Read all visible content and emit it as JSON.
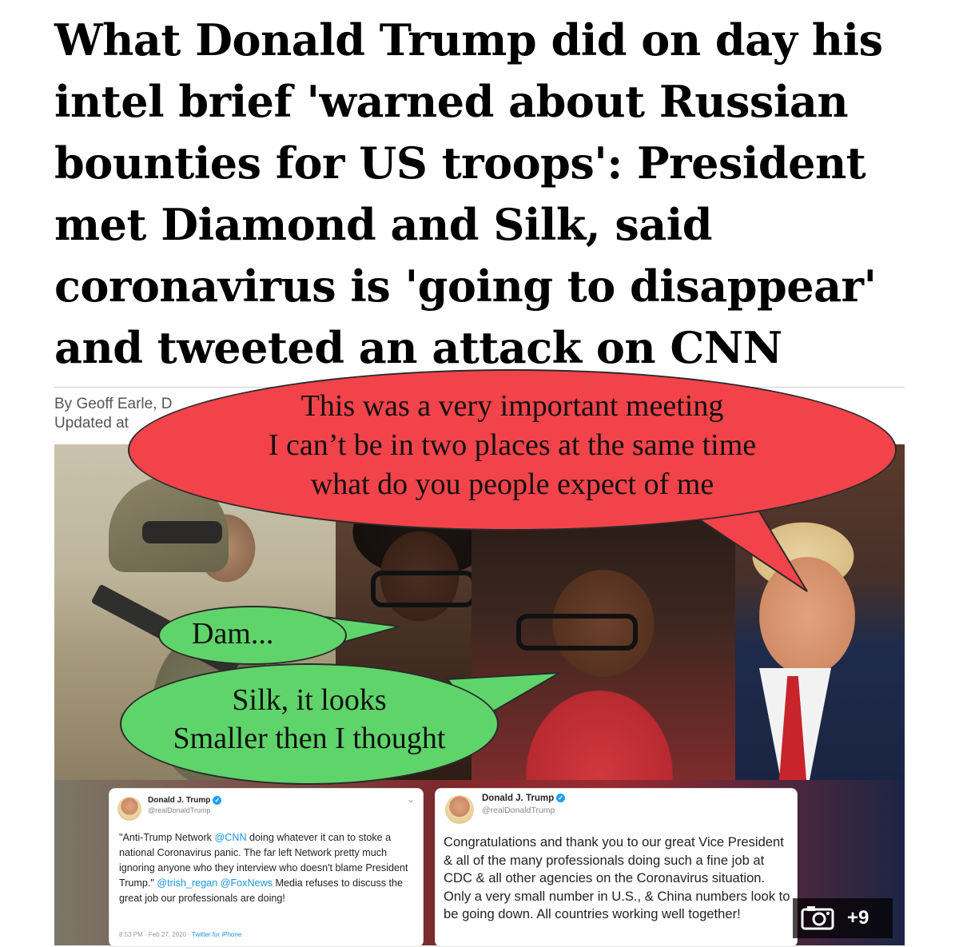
{
  "article": {
    "headline": "What Donald Trump did on day his intel brief 'warned about Russian bounties for US troops': President met Diamond and Silk, said coronavirus is 'going to disappear' and tweeted an attack on CNN",
    "byline": "By Geoff Earle, D",
    "updated": "Updated at"
  },
  "speech_bubbles": {
    "red_lines": [
      "This was a very important meeting",
      "I can’t be in two places at the same time",
      "what do you people expect of me"
    ],
    "green_small": "Dam...",
    "green_large_lines": [
      "Silk, it looks",
      "Smaller then I thought"
    ]
  },
  "tweets": [
    {
      "name": "Donald J. Trump",
      "handle": "@realDonaldTrump",
      "text_parts": [
        "\"Anti-Trump Network ",
        "@CNN",
        " doing whatever it can to stoke a national Coronavirus panic. The far left Network pretty much ignoring anyone who they interview who doesn't blame President Trump.\" ",
        "@trish_regan",
        " ",
        "@FoxNews",
        " Media refuses to discuss the great job our professionals are doing!"
      ],
      "meta": "8:53 PM · Feb 27, 2020 · ",
      "source": "Twitter for iPhone"
    },
    {
      "name": "Donald J. Trump",
      "handle": "@realDonaldTrump",
      "text": "Congratulations and thank you to our great Vice President & all of the many professionals doing such a fine job at CDC & all other agencies on the Coronavirus situation. Only a very small number in U.S., & China numbers look to be going down. All countries working well together!"
    }
  ],
  "gallery": {
    "extra_count": "+9",
    "icon": "camera-icon"
  },
  "colors": {
    "red_bubble": "#f2434a",
    "green_bubble": "#5fd46a",
    "link": "#1b95e0"
  }
}
